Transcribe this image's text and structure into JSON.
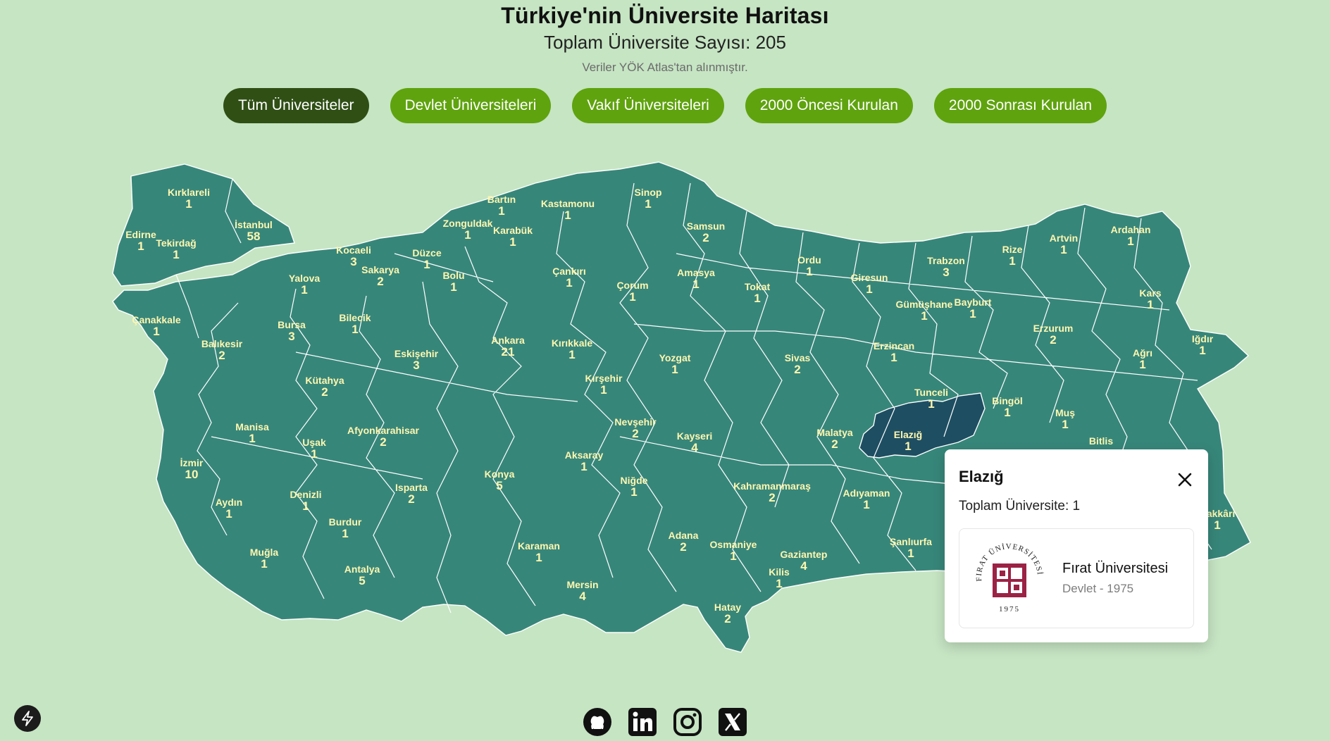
{
  "header": {
    "title": "Türkiye'nin Üniversite Haritası",
    "subtitle": "Toplam Üniversite Sayısı: 205",
    "source": "Veriler YÖK Atlas'tan alınmıştır."
  },
  "filters": [
    {
      "label": "Tüm Üniversiteler",
      "active": true
    },
    {
      "label": "Devlet Üniversiteleri",
      "active": false
    },
    {
      "label": "Vakıf Üniversiteleri",
      "active": false
    },
    {
      "label": "2000 Öncesi Kurulan",
      "active": false
    },
    {
      "label": "2000 Sonrası Kurulan",
      "active": false
    }
  ],
  "colors": {
    "background": "#c6e5c3",
    "province_fill": "#37867a",
    "province_selected": "#1e4e62",
    "button": "#5fa30e",
    "button_active": "#2f4f15",
    "label_text": "#fff7b0"
  },
  "provinces": [
    {
      "name": "Kırklareli",
      "count": "1"
    },
    {
      "name": "Edirne",
      "count": "1"
    },
    {
      "name": "Tekirdağ",
      "count": "1"
    },
    {
      "name": "İstanbul",
      "count": "58"
    },
    {
      "name": "Kocaeli",
      "count": "3"
    },
    {
      "name": "Yalova",
      "count": "1"
    },
    {
      "name": "Sakarya",
      "count": "2"
    },
    {
      "name": "Düzce",
      "count": "1"
    },
    {
      "name": "Zonguldak",
      "count": "1"
    },
    {
      "name": "Bartın",
      "count": "1"
    },
    {
      "name": "Karabük",
      "count": "1"
    },
    {
      "name": "Kastamonu",
      "count": "1"
    },
    {
      "name": "Sinop",
      "count": "1"
    },
    {
      "name": "Samsun",
      "count": "2"
    },
    {
      "name": "Bolu",
      "count": "1"
    },
    {
      "name": "Çankırı",
      "count": "1"
    },
    {
      "name": "Çorum",
      "count": "1"
    },
    {
      "name": "Amasya",
      "count": "1"
    },
    {
      "name": "Tokat",
      "count": "1"
    },
    {
      "name": "Ordu",
      "count": "1"
    },
    {
      "name": "Giresun",
      "count": "1"
    },
    {
      "name": "Trabzon",
      "count": "3"
    },
    {
      "name": "Rize",
      "count": "1"
    },
    {
      "name": "Artvin",
      "count": "1"
    },
    {
      "name": "Ardahan",
      "count": "1"
    },
    {
      "name": "Gümüşhane",
      "count": "1"
    },
    {
      "name": "Bayburt",
      "count": "1"
    },
    {
      "name": "Kars",
      "count": "1"
    },
    {
      "name": "Çanakkale",
      "count": "1"
    },
    {
      "name": "Bursa",
      "count": "3"
    },
    {
      "name": "Bilecik",
      "count": "1"
    },
    {
      "name": "Balıkesir",
      "count": "2"
    },
    {
      "name": "Ankara",
      "count": "21"
    },
    {
      "name": "Eskişehir",
      "count": "3"
    },
    {
      "name": "Kırıkkale",
      "count": "1"
    },
    {
      "name": "Yozgat",
      "count": "1"
    },
    {
      "name": "Sivas",
      "count": "2"
    },
    {
      "name": "Erzincan",
      "count": "1"
    },
    {
      "name": "Erzurum",
      "count": "2"
    },
    {
      "name": "Iğdır",
      "count": "1"
    },
    {
      "name": "Ağrı",
      "count": "1"
    },
    {
      "name": "Kütahya",
      "count": "2"
    },
    {
      "name": "Kırşehir",
      "count": "1"
    },
    {
      "name": "Tunceli",
      "count": "1"
    },
    {
      "name": "Bingöl",
      "count": "1"
    },
    {
      "name": "Manisa",
      "count": "1"
    },
    {
      "name": "Uşak",
      "count": "1"
    },
    {
      "name": "Afyonkarahisar",
      "count": "2"
    },
    {
      "name": "Nevşehir",
      "count": "2"
    },
    {
      "name": "Kayseri",
      "count": "4"
    },
    {
      "name": "Malatya",
      "count": "2"
    },
    {
      "name": "Elazığ",
      "count": "1"
    },
    {
      "name": "Muş",
      "count": "1"
    },
    {
      "name": "Bitlis",
      "count": ""
    },
    {
      "name": "İzmir",
      "count": "10"
    },
    {
      "name": "Aksaray",
      "count": "1"
    },
    {
      "name": "Konya",
      "count": "5"
    },
    {
      "name": "Niğde",
      "count": "1"
    },
    {
      "name": "Kahramanmaraş",
      "count": "2"
    },
    {
      "name": "Adıyaman",
      "count": "1"
    },
    {
      "name": "Denizli",
      "count": "1"
    },
    {
      "name": "Isparta",
      "count": "2"
    },
    {
      "name": "Aydın",
      "count": "1"
    },
    {
      "name": "Burdur",
      "count": "1"
    },
    {
      "name": "Karaman",
      "count": "1"
    },
    {
      "name": "Adana",
      "count": "2"
    },
    {
      "name": "Osmaniye",
      "count": "1"
    },
    {
      "name": "Şanlıurfa",
      "count": "1"
    },
    {
      "name": "Gaziantep",
      "count": "4"
    },
    {
      "name": "Kilis",
      "count": "1"
    },
    {
      "name": "Muğla",
      "count": "1"
    },
    {
      "name": "Antalya",
      "count": "5"
    },
    {
      "name": "Mersin",
      "count": "4"
    },
    {
      "name": "Hatay",
      "count": "2"
    },
    {
      "name": "Hakkâri",
      "count": "1"
    }
  ],
  "popup": {
    "province": "Elazığ",
    "total": "Toplam Üniversite: 1",
    "university": {
      "name": "Fırat Üniversitesi",
      "meta": "Devlet - 1975",
      "logo_text": "FIRAT ÜNİVERSİTESİ",
      "logo_year": "1975",
      "logo_color": "#9b2245"
    }
  },
  "footer": {
    "socials": [
      "github-icon",
      "linkedin-icon",
      "instagram-icon",
      "x-icon"
    ]
  }
}
